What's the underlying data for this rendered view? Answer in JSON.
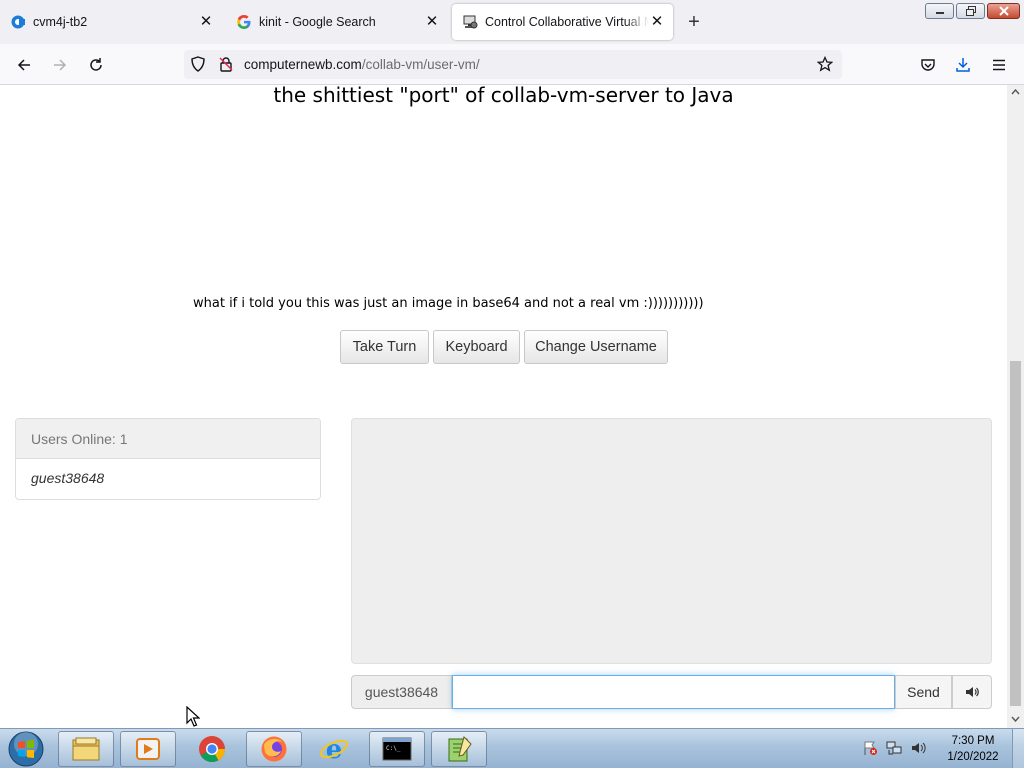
{
  "browser": {
    "tabs": [
      {
        "title": "cvm4j-tb2",
        "icon": "collabvm-icon",
        "active": false
      },
      {
        "title": "kinit - Google Search",
        "icon": "google-icon",
        "active": false
      },
      {
        "title": "Control Collaborative Virtual M",
        "icon": "collabvm-computer-icon",
        "active": true
      }
    ],
    "url": {
      "domain": "computernewb.com",
      "path": "/collab-vm/user-vm/"
    }
  },
  "page": {
    "vm_title": "the shittiest \"port\" of collab-vm-server to Java",
    "vm_caption": "what if i told you this was just an image in base64 and not a real vm :)))))))))))",
    "buttons": {
      "take_turn": "Take Turn",
      "keyboard": "Keyboard",
      "change_username": "Change Username"
    },
    "users": {
      "heading": "Users Online: 1",
      "list": [
        "guest38648"
      ]
    },
    "chat": {
      "username": "guest38648",
      "input_value": "",
      "send_label": "Send"
    }
  },
  "taskbar": {
    "apps": [
      "windows-explorer",
      "media-player",
      "chrome",
      "firefox",
      "internet-explorer",
      "command-prompt",
      "notepad-plus"
    ],
    "clock": {
      "time": "7:30 PM",
      "date": "1/20/2022"
    }
  },
  "colors": {
    "accent_focus": "#66afe9",
    "tab_bg": "#f0f0f4",
    "taskbar": "#a9c3dc"
  }
}
